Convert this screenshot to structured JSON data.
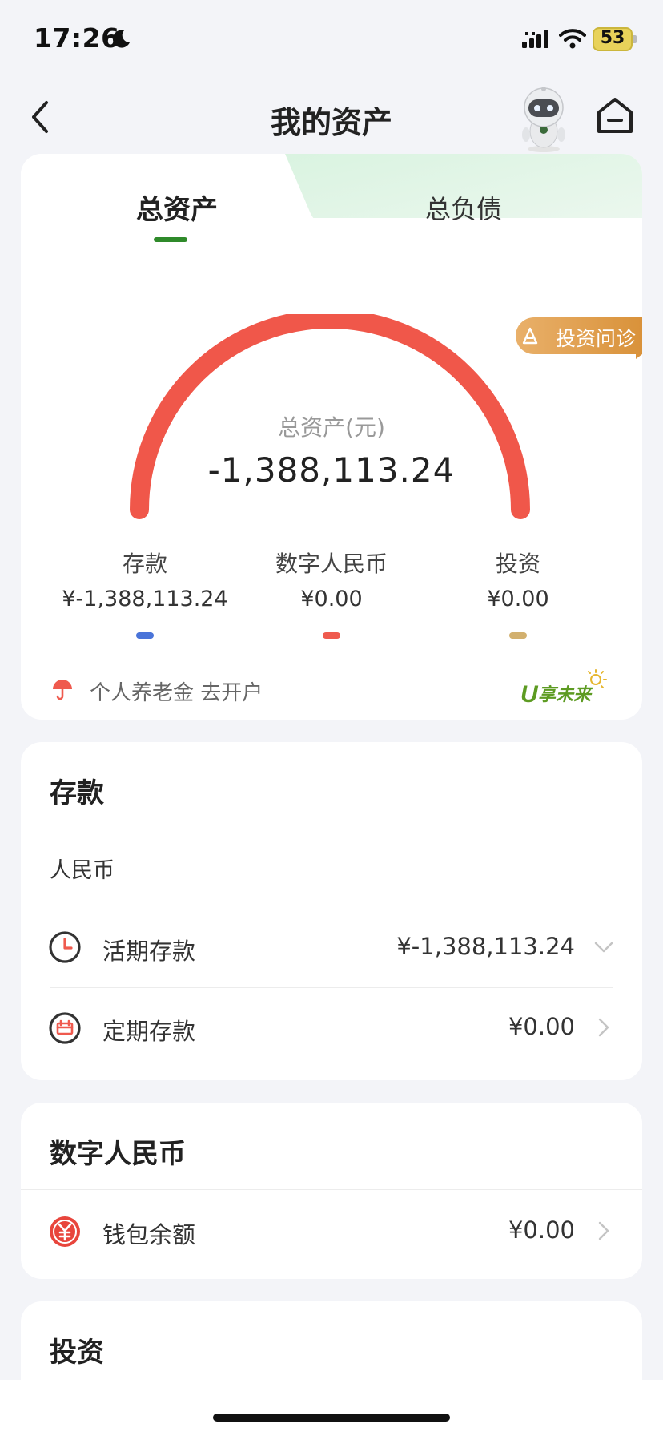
{
  "status_bar": {
    "time": "17:26",
    "battery": "53"
  },
  "nav": {
    "title": "我的资产"
  },
  "tabs": {
    "total_assets": "总资产",
    "total_liabilities": "总负债"
  },
  "gauge": {
    "label": "总资产(元)",
    "value": "-1,388,113.24"
  },
  "diagnosis_badge": {
    "label": "投资问诊"
  },
  "categories": [
    {
      "label": "存款",
      "value": "¥-1,388,113.24",
      "color": "#4a74d9"
    },
    {
      "label": "数字人民币",
      "value": "¥0.00",
      "color": "#ef5a4e"
    },
    {
      "label": "投资",
      "value": "¥0.00",
      "color": "#d2b06e"
    }
  ],
  "pension": {
    "text": "个人养老金 去开户",
    "logo_text": "U享未来"
  },
  "deposit": {
    "title": "存款",
    "currency": "人民币",
    "rows": [
      {
        "label": "活期存款",
        "value": "¥-1,388,113.24",
        "icon": "clock-icon",
        "chevron": "chevron-down-icon"
      },
      {
        "label": "定期存款",
        "value": "¥0.00",
        "icon": "calendar-icon",
        "chevron": "chevron-right-icon"
      }
    ]
  },
  "digital_rmb": {
    "title": "数字人民币",
    "rows": [
      {
        "label": "钱包余额",
        "value": "¥0.00",
        "icon": "yuan-icon",
        "chevron": "chevron-right-icon"
      }
    ]
  },
  "investment": {
    "title": "投资"
  },
  "colors": {
    "accent_green": "#2f8a2a",
    "gauge_red": "#f0574a",
    "badge_orange": "#e2a04c"
  }
}
